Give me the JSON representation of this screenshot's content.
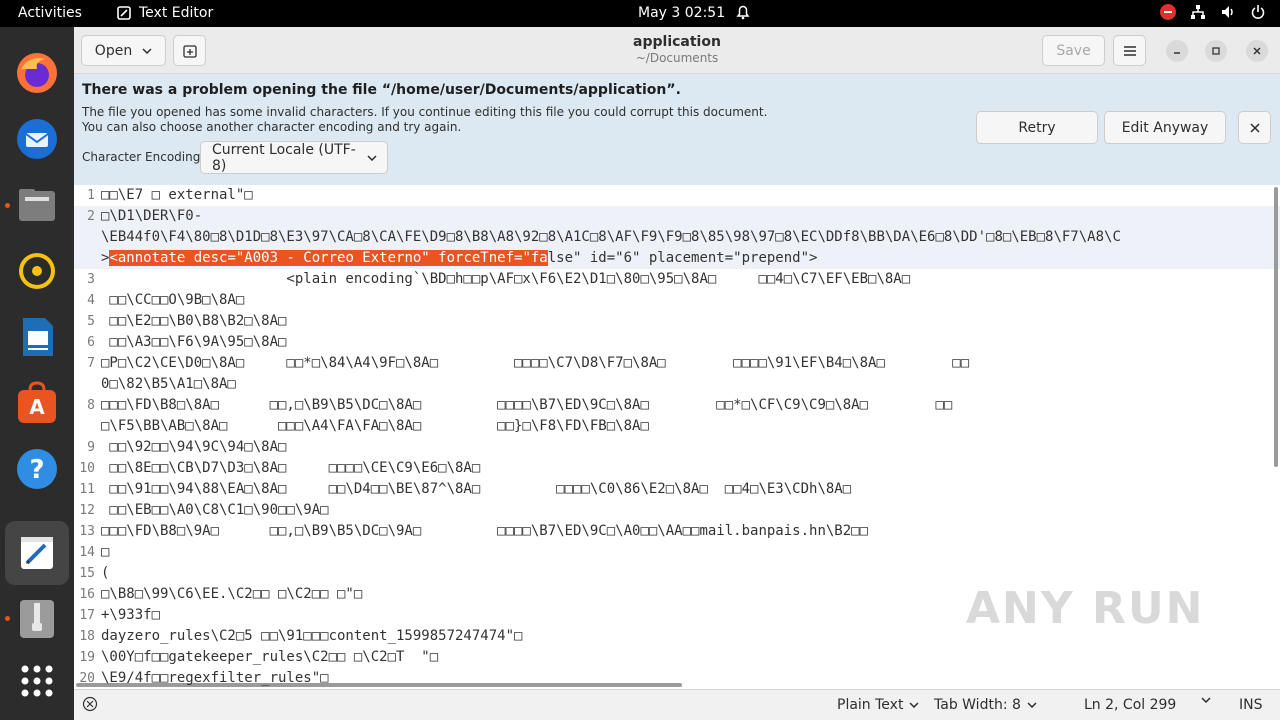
{
  "topbar": {
    "activities": "Activities",
    "app_name": "Text Editor",
    "clock": "May 3  02:51"
  },
  "dock": {
    "items": [
      "firefox-icon",
      "thunderbird-icon",
      "files-icon",
      "rhythmbox-icon",
      "writer-icon",
      "software-icon",
      "help-icon",
      "text-editor-icon",
      "archive-icon",
      "apps-grid-icon"
    ]
  },
  "header": {
    "open_label": "Open",
    "title": "application",
    "subtitle": "~/Documents",
    "save_label": "Save"
  },
  "infobar": {
    "title": "There was a problem opening the file “/home/user/Documents/application”.",
    "line1": "The file you opened has some invalid characters. If you continue editing this file you could corrupt this document.",
    "line2": "You can also choose another character encoding and try again.",
    "encoding_label": "Character Encoding:",
    "encoding_value": "Current Locale (UTF-8)",
    "retry_label": "Retry",
    "edit_anyway_label": "Edit Anyway"
  },
  "editor": {
    "lines": [
      {
        "n": "1",
        "t": "□□\\E7 □ external\"□"
      },
      {
        "n": "2",
        "t": "□\\D1\\DER\\F0-"
      },
      {
        "n": "",
        "t": "\\EB44f0\\F4\\80□8\\D1D□8\\E3\\97\\CA□8\\CA\\FE\\D9□8\\B8\\A8\\92□8\\A1C□8\\AF\\F9\\F9□8\\85\\98\\97□8\\EC\\DDf8\\BB\\DA\\E6□8\\DD'□8□\\EB□8\\F7\\A8\\C"
      },
      {
        "n": "",
        "pre": ">",
        "sel": "<annotate desc=\"A003 - Correo Externo\" forceTnef=\"fa",
        "post": "lse\" id=\"6\" placement=\"prepend\">"
      },
      {
        "n": "3",
        "t": "                      <plain encoding`\\BD□h□□p\\AF□x\\F6\\E2\\D1□\\80□\\95□\\8A□     □□4□\\C7\\EF\\EB□\\8A□"
      },
      {
        "n": "4",
        "t": " □□\\CC□□O\\9B□\\8A□"
      },
      {
        "n": "5",
        "t": " □□\\E2□□\\B0\\B8\\B2□\\8A□"
      },
      {
        "n": "6",
        "t": " □□\\A3□□\\F6\\9A\\95□\\8A□"
      },
      {
        "n": "7",
        "t": "□P□\\C2\\CE\\D0□\\8A□     □□*□\\84\\A4\\9F□\\8A□         □□□□\\C7\\D8\\F7□\\8A□        □□□□\\91\\EF\\B4□\\8A□        □□"
      },
      {
        "n": "",
        "t": "0□\\82\\B5\\A1□\\8A□"
      },
      {
        "n": "8",
        "t": "□□□\\FD\\B8□\\8A□      □□,□\\B9\\B5\\DC□\\8A□         □□□□\\B7\\ED\\9C□\\8A□        □□*□\\CF\\C9\\C9□\\8A□        □□"
      },
      {
        "n": "",
        "t": "□\\F5\\BB\\AB□\\8A□      □□□\\A4\\FA\\FA□\\8A□         □□}□\\F8\\FD\\FB□\\8A□"
      },
      {
        "n": "9",
        "t": " □□\\92□□\\94\\9C\\94□\\8A□"
      },
      {
        "n": "10",
        "t": " □□\\8E□□\\CB\\D7\\D3□\\8A□     □□□□\\CE\\C9\\E6□\\8A□"
      },
      {
        "n": "11",
        "t": " □□\\91□□\\94\\88\\EA□\\8A□     □□\\D4□□\\BE\\87^\\8A□         □□□□\\C0\\86\\E2□\\8A□  □□4□\\E3\\CDh\\8A□"
      },
      {
        "n": "12",
        "t": " □□\\EB□□\\A0\\C8\\C1□\\90□□\\9A□"
      },
      {
        "n": "13",
        "t": "□□□\\FD\\B8□\\9A□      □□,□\\B9\\B5\\DC□\\9A□         □□□□\\B7\\ED\\9C□\\A0□□\\AA□□mail.banpais.hn\\B2□□"
      },
      {
        "n": "14",
        "t": "□"
      },
      {
        "n": "15",
        "t": "("
      },
      {
        "n": "16",
        "t": "□\\B8□\\99\\C6\\EE.\\C2□□ □\\C2□□ □\"□"
      },
      {
        "n": "17",
        "t": "+\\933f□"
      },
      {
        "n": "18",
        "t": "dayzero_rules\\C2□5 □□\\91□□□content_1599857247474\"□"
      },
      {
        "n": "19",
        "t": "\\00Y□f□□gatekeeper_rules\\C2□□ □\\C2□T  \"□"
      },
      {
        "n": "20",
        "t": "\\E9/4f□□regexfilter_rules\"□"
      }
    ]
  },
  "statusbar": {
    "language": "Plain Text",
    "tab_width": "Tab Width: 8",
    "position": "Ln 2, Col 299",
    "mode": "INS"
  },
  "watermark": "ANY RUN"
}
